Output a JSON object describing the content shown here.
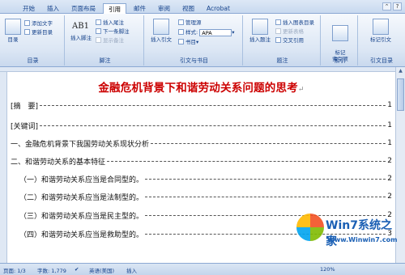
{
  "tabs": [
    "开始",
    "插入",
    "页面布局",
    "引用",
    "邮件",
    "审阅",
    "视图",
    "Acrobat"
  ],
  "active_tab": "引用",
  "ribbon": {
    "toc_group": {
      "label": "目录",
      "toc_button": "目录",
      "add_text": "添加文字",
      "update_toc": "更新目录"
    },
    "footnote_group": {
      "label": "脚注",
      "insert_footnote": "插入脚注",
      "insert_endnote": "插入尾注",
      "next_footnote": "下一条脚注",
      "show_notes": "显示备注",
      "ab_glyph": "AB1"
    },
    "citation_group": {
      "label": "引文与书目",
      "insert_citation": "插入引文",
      "manage_sources": "管理源",
      "style_label": "样式:",
      "style_value": "APA",
      "bibliography": "书目"
    },
    "caption_group": {
      "label": "题注",
      "insert_caption": "插入题注",
      "insert_table_of_figures": "插入图表目录",
      "update_table": "更新表格",
      "cross_reference": "交叉引用"
    },
    "index_group": {
      "label": "索引",
      "mark_entry": "标记\n索引项"
    },
    "toa_group": {
      "label": "引文目录",
      "mark_citation": "标记引文"
    }
  },
  "document": {
    "title": "金融危机背景下和谐劳动关系问题的思考",
    "toc": [
      {
        "text": "[摘　要]",
        "page": "1"
      },
      {
        "text": "[关键词]",
        "page": "1"
      },
      {
        "text": "一、金融危机背景下我国劳动关系现状分析",
        "page": "1"
      },
      {
        "text": "二、和谐劳动关系的基本特征",
        "page": "2"
      },
      {
        "text": "（一）和谐劳动关系应当是合同型的。",
        "page": "2"
      },
      {
        "text": "（二）和谐劳动关系应当是法制型的。",
        "page": "2"
      },
      {
        "text": "（三）和谐劳动关系应当是民主型的。",
        "page": "2"
      },
      {
        "text": "（四）和谐劳动关系应当是救助型的。",
        "page": "3"
      }
    ]
  },
  "status": {
    "page": "页面: 1/3",
    "words": "字数: 1,779",
    "language": "英语(美国)",
    "mode": "插入",
    "zoom": "120%"
  },
  "watermark": {
    "brand": "Win7系统之家",
    "url": "Www.Winwin7.com"
  }
}
